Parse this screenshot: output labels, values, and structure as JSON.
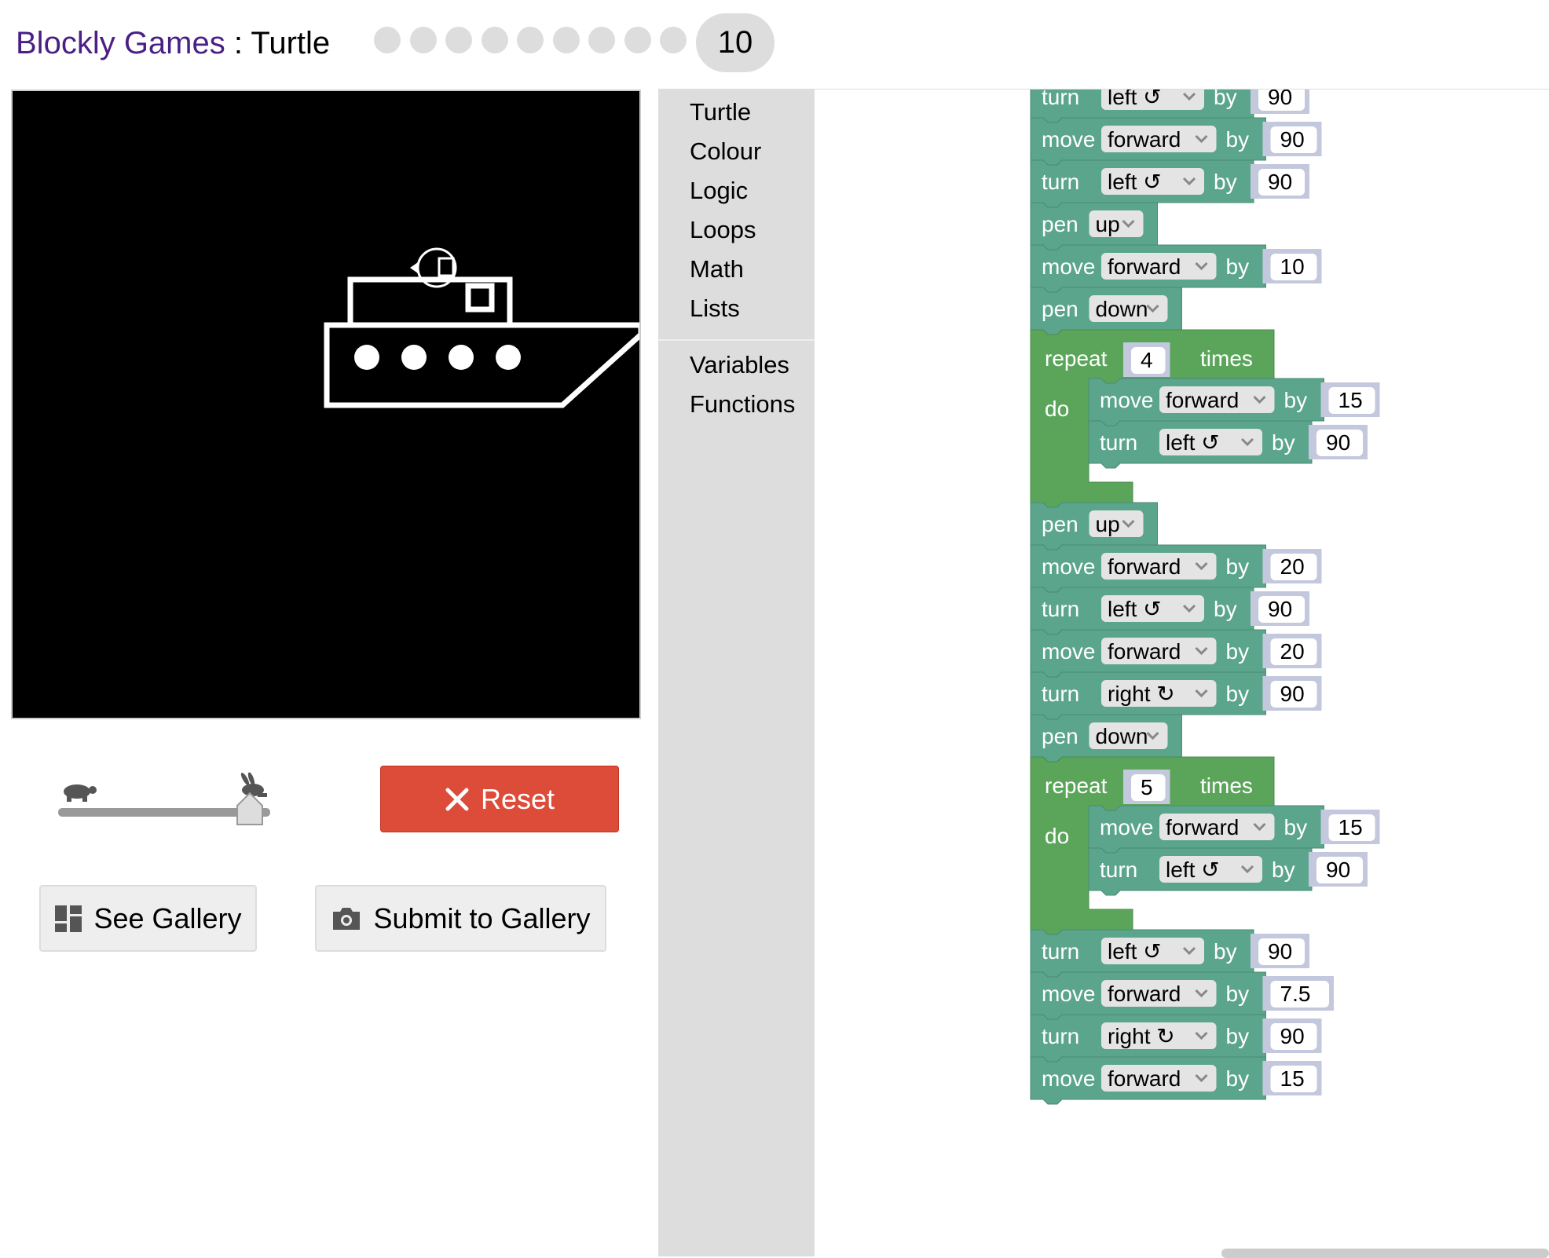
{
  "header": {
    "brand": "Blockly Games",
    "separator": " : ",
    "app_name": "Turtle",
    "levels": [
      "1",
      "2",
      "3",
      "4",
      "5",
      "6",
      "7",
      "8",
      "9"
    ],
    "current_level": "10"
  },
  "speed_slider": {
    "value": 1.0,
    "slow_icon": "turtle-icon",
    "fast_icon": "rabbit-icon"
  },
  "buttons": {
    "reset": "Reset",
    "see_gallery": "See Gallery",
    "submit_gallery": "Submit to Gallery"
  },
  "toolbox": {
    "categories": [
      "Turtle",
      "Colour",
      "Logic",
      "Loops",
      "Math",
      "Lists"
    ],
    "extra_categories": [
      "Variables",
      "Functions"
    ]
  },
  "colors": {
    "brand": "#4a1f86",
    "reset": "#dd4b39",
    "turtle_block": "#5ba58c",
    "loop_block": "#5ba55b",
    "number_block": "#c3c8dc"
  },
  "program": [
    {
      "kind": "turn",
      "dir": "left ↺",
      "val": "90"
    },
    {
      "kind": "move",
      "dir": "forward",
      "val": "90"
    },
    {
      "kind": "turn",
      "dir": "left ↺",
      "val": "90"
    },
    {
      "kind": "pen",
      "state": "up"
    },
    {
      "kind": "move",
      "dir": "forward",
      "val": "10"
    },
    {
      "kind": "pen",
      "state": "down"
    },
    {
      "kind": "repeat",
      "times": "4",
      "body": [
        {
          "kind": "move",
          "dir": "forward",
          "val": "15"
        },
        {
          "kind": "turn",
          "dir": "left ↺",
          "val": "90"
        }
      ]
    },
    {
      "kind": "pen",
      "state": "up"
    },
    {
      "kind": "move",
      "dir": "forward",
      "val": "20"
    },
    {
      "kind": "turn",
      "dir": "left ↺",
      "val": "90"
    },
    {
      "kind": "move",
      "dir": "forward",
      "val": "20"
    },
    {
      "kind": "turn",
      "dir": "right ↻",
      "val": "90"
    },
    {
      "kind": "pen",
      "state": "down"
    },
    {
      "kind": "repeat",
      "times": "5",
      "body": [
        {
          "kind": "move",
          "dir": "forward",
          "val": "15"
        },
        {
          "kind": "turn",
          "dir": "left ↺",
          "val": "90"
        }
      ]
    },
    {
      "kind": "turn",
      "dir": "left ↺",
      "val": "90"
    },
    {
      "kind": "move",
      "dir": "forward",
      "val": "7.5"
    },
    {
      "kind": "turn",
      "dir": "right ↻",
      "val": "90"
    },
    {
      "kind": "move",
      "dir": "forward",
      "val": "15"
    }
  ],
  "block_words": {
    "turn": "turn",
    "move": "move",
    "pen": "pen",
    "by": "by",
    "repeat": "repeat",
    "times": "times",
    "do": "do"
  }
}
